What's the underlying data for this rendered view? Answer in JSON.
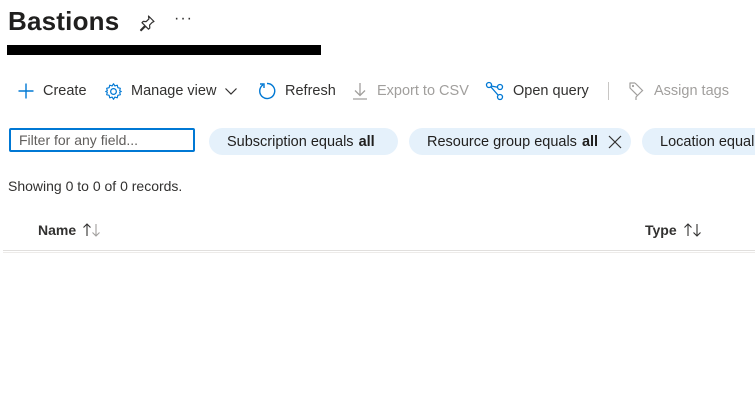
{
  "page": {
    "title": "Bastions"
  },
  "toolbar": {
    "create": "Create",
    "manage_view": "Manage view",
    "refresh": "Refresh",
    "export_csv": "Export to CSV",
    "open_query": "Open query",
    "assign_tags": "Assign tags"
  },
  "filters": {
    "search_placeholder": "Filter for any field...",
    "pills": [
      {
        "label": "Subscription equals",
        "value": "all"
      },
      {
        "label": "Resource group equals",
        "value": "all"
      },
      {
        "label": "Location equal",
        "value": ""
      }
    ]
  },
  "status": {
    "records_text": "Showing 0 to 0 of 0 records."
  },
  "table": {
    "columns": [
      "Name",
      "Type"
    ]
  },
  "colors": {
    "accent": "#0078d4",
    "pill_bg": "#e5f1fb",
    "disabled_text": "#a19f9d"
  }
}
